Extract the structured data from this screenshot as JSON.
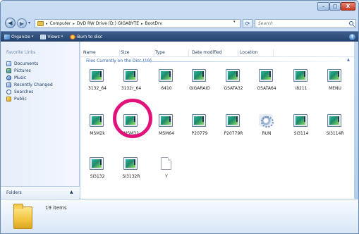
{
  "window": {
    "min_glyph": "–",
    "max_glyph": "□",
    "close_glyph": "X"
  },
  "address": {
    "crumbs": [
      "Computer",
      "DVD RW Drive (D:) GIGABYTE",
      "BootDrv"
    ],
    "separator": "▸"
  },
  "search": {
    "placeholder": "Search"
  },
  "toolbar": {
    "organize": "Organize",
    "views": "Views",
    "burn": "Burn to disc"
  },
  "nav": {
    "heading": "Favorite Links",
    "items": [
      "Documents",
      "Pictures",
      "Music",
      "Recently Changed",
      "Searches",
      "Public"
    ],
    "folders": "Folders"
  },
  "columns": [
    "Name",
    "Size",
    "Type",
    "Date modified",
    "Location"
  ],
  "group": {
    "label": "Files Currently on the Disc (19)"
  },
  "files": [
    {
      "name": "3132_64",
      "icon": "disk-image-icon"
    },
    {
      "name": "3132r_64",
      "icon": "disk-image-icon"
    },
    {
      "name": "6410",
      "icon": "disk-image-icon"
    },
    {
      "name": "GIGARAID",
      "icon": "disk-image-icon"
    },
    {
      "name": "GSATA32",
      "icon": "disk-image-icon"
    },
    {
      "name": "GSATA64",
      "icon": "disk-image-icon"
    },
    {
      "name": "i8211",
      "icon": "disk-image-icon"
    },
    {
      "name": "MENU",
      "icon": "disk-image-icon"
    },
    {
      "name": "MSM2k",
      "icon": "disk-image-icon"
    },
    {
      "name": "MSM32",
      "icon": "disk-image-icon"
    },
    {
      "name": "MSM64",
      "icon": "disk-image-icon"
    },
    {
      "name": "P20779",
      "icon": "disk-image-icon"
    },
    {
      "name": "P20779R",
      "icon": "disk-image-icon"
    },
    {
      "name": "RUN",
      "icon": "settings-file-icon"
    },
    {
      "name": "SI3114",
      "icon": "disk-image-icon"
    },
    {
      "name": "SI3114R",
      "icon": "disk-image-icon"
    },
    {
      "name": "SI3132",
      "icon": "disk-image-icon"
    },
    {
      "name": "SI3132R",
      "icon": "disk-image-icon"
    },
    {
      "name": "Y",
      "icon": "blank-document-icon"
    }
  ],
  "status": {
    "count": "19 items"
  },
  "colors": {
    "toolbar": "#24426c",
    "highlight": "#e3127a",
    "link": "#2d62ad"
  }
}
